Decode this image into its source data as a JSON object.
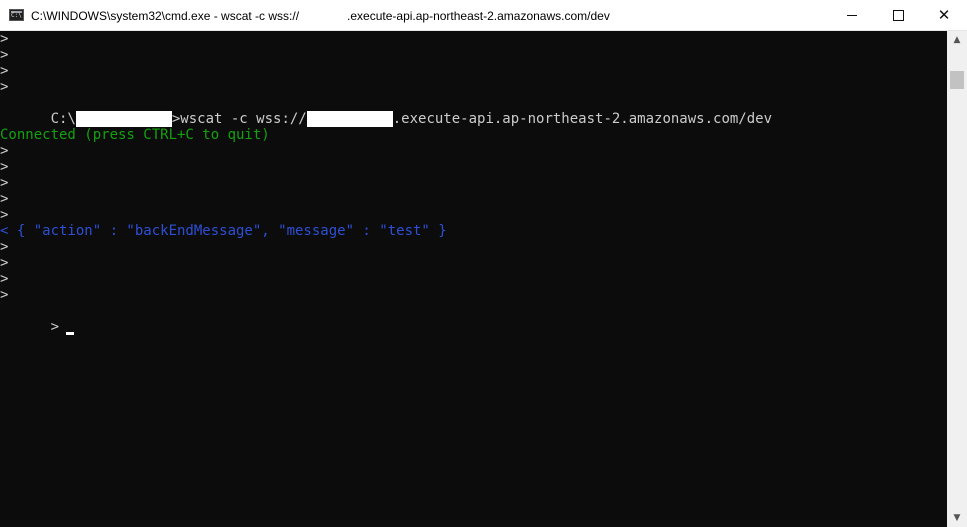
{
  "window": {
    "title_prefix": "C:\\WINDOWS\\system32\\cmd.exe - wscat  -c wss://",
    "title_suffix": ".execute-api.ap-northeast-2.amazonaws.com/dev",
    "minimize_icon": "minimize-icon",
    "maximize_icon": "maximize-icon",
    "close_icon": "close-icon",
    "close_glyph": "✕"
  },
  "console": {
    "prompt_char": ">",
    "command_prefix": "C:\\",
    "command_mid": ">wscat -c wss://",
    "command_suffix": ".execute-api.ap-northeast-2.amazonaws.com/dev",
    "connected": "Connected (press CTRL+C to quit)",
    "received": "< { \"action\" : \"backEndMessage\", \"message\" : \"test\" }"
  },
  "scrollbar": {
    "up_glyph": "▲",
    "down_glyph": "▼"
  },
  "colors": {
    "console_bg": "#0c0c0c",
    "console_text": "#cccccc",
    "connected_text": "#13a10e",
    "received_text": "#2d4fd6"
  }
}
